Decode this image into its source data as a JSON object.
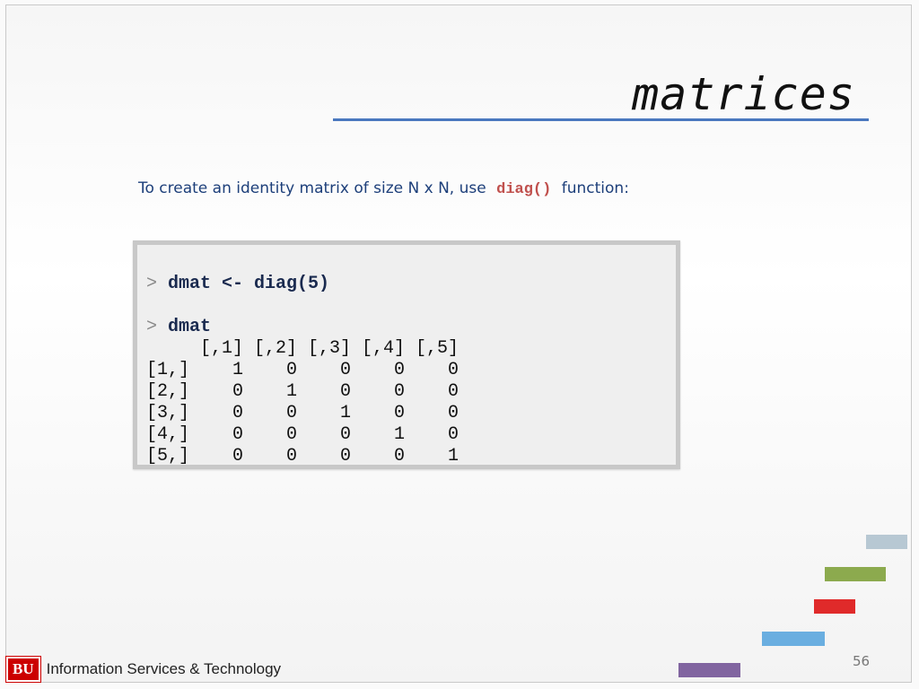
{
  "slide": {
    "title": "matrices",
    "intro_before": "To create an identity matrix of size N x N, use",
    "intro_code": "diag()",
    "intro_after": "function:",
    "page_number": "56"
  },
  "console": {
    "lines": [
      {
        "kind": "command",
        "prompt": ">",
        "text": "dmat <- diag(5)"
      },
      {
        "kind": "blank"
      },
      {
        "kind": "command",
        "prompt": ">",
        "text": "dmat"
      },
      {
        "kind": "output",
        "text": "     [,1] [,2] [,3] [,4] [,5]"
      },
      {
        "kind": "output",
        "text": "[1,]    1    0    0    0    0"
      },
      {
        "kind": "output",
        "text": "[2,]    0    1    0    0    0"
      },
      {
        "kind": "output",
        "text": "[3,]    0    0    1    0    0"
      },
      {
        "kind": "output",
        "text": "[4,]    0    0    0    1    0"
      },
      {
        "kind": "output",
        "text": "[5,]    0    0    0    0    1"
      }
    ]
  },
  "footer": {
    "logo_text": "BU",
    "org_text": "Information Services & Technology"
  },
  "colors": {
    "accent_rule": "#4a78bf",
    "code_keyword": "#c0504d",
    "intro_text": "#1d3f7a",
    "logo_red": "#cc0000",
    "bar_gray_blue": "#b7c8d3",
    "bar_green": "#8caa4e",
    "bar_red": "#e02a2a",
    "bar_blue": "#6aaee0",
    "bar_purple": "#8165a0"
  }
}
